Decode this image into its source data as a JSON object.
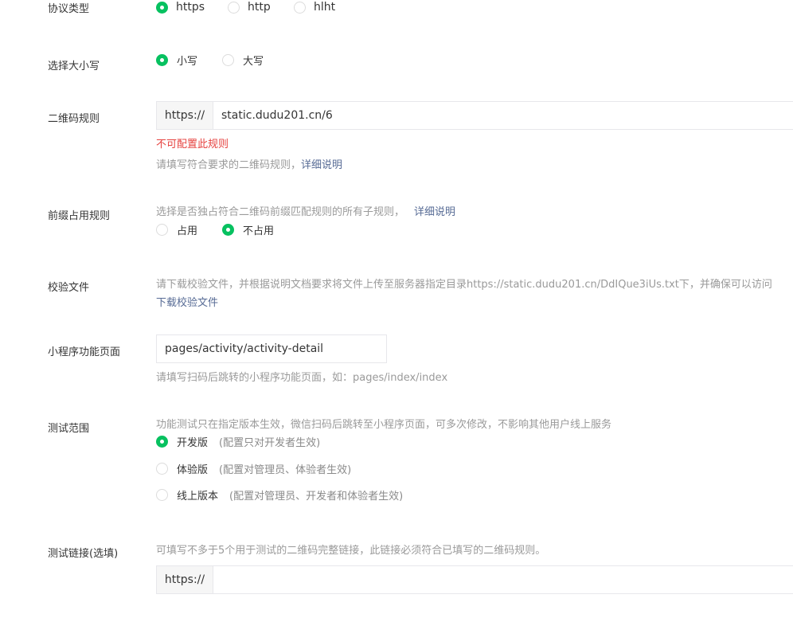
{
  "protocol": {
    "label": "协议类型",
    "options": [
      "https",
      "http",
      "hlht"
    ],
    "selected": "https"
  },
  "case": {
    "label": "选择大小写",
    "options": [
      "小写",
      "大写"
    ],
    "selected": "小写"
  },
  "qr_rule": {
    "label": "二维码规则",
    "prefix": "https://",
    "value": "static.dudu201.cn/6",
    "error": "不可配置此规则",
    "tip": "请填写符合要求的二维码规则，",
    "tip_link": "详细说明"
  },
  "prefix_rule": {
    "label": "前缀占用规则",
    "tip": "选择是否独占符合二维码前缀匹配规则的所有子规则，",
    "tip_link": "详细说明",
    "options": [
      "占用",
      "不占用"
    ],
    "selected": "不占用"
  },
  "verify_file": {
    "label": "校验文件",
    "tip": "请下载校验文件，并根据说明文档要求将文件上传至服务器指定目录https://static.dudu201.cn/DdIQue3iUs.txt下，并确保可以访问",
    "download_link": "下载校验文件"
  },
  "mini_page": {
    "label": "小程序功能页面",
    "value": "pages/activity/activity-detail",
    "tip": "请填写扫码后跳转的小程序功能页面，如：pages/index/index"
  },
  "test_scope": {
    "label": "测试范围",
    "tip": "功能测试只在指定版本生效，微信扫码后跳转至小程序页面，可多次修改，不影响其他用户线上服务",
    "options": [
      {
        "label": "开发版",
        "note": "(配置只对开发者生效)"
      },
      {
        "label": "体验版",
        "note": "(配置对管理员、体验者生效)"
      },
      {
        "label": "线上版本",
        "note": "(配置对管理员、开发者和体验者生效)"
      }
    ],
    "selected": "开发版"
  },
  "test_links": {
    "label": "测试链接(选填)",
    "tip": "可填写不多于5个用于测试的二维码完整链接，此链接必须符合已填写的二维码规则。",
    "prefix": "https://",
    "value": ""
  }
}
